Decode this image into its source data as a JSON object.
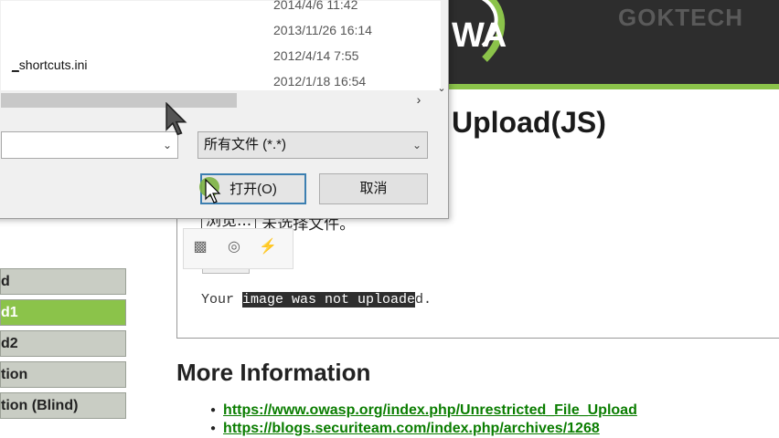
{
  "dialog": {
    "file_name": "shortcuts.ini",
    "dates": [
      "2014/4/6 11:42",
      "2013/11/26 16:14",
      "2012/4/14 7:55",
      "2012/1/18 16:54"
    ],
    "file_type": "所有文件 (*.*)",
    "open_label": "打开(O)",
    "cancel_label": "取消"
  },
  "header": {
    "logo_text": "WA",
    "watermark": "GOKTECH"
  },
  "page": {
    "title": "Upload(JS)",
    "browse_label": "浏览...",
    "no_file_text": "未选择文件。",
    "result_prefix": "Your ",
    "result_highlight": "image was not uploade",
    "result_suffix": "d."
  },
  "menu": {
    "items": [
      {
        "label": "d"
      },
      {
        "label": "d1"
      },
      {
        "label": "d2"
      },
      {
        "label": "tion"
      },
      {
        "label": "tion (Blind)"
      }
    ]
  },
  "more_info": {
    "heading": "More Information",
    "links": [
      "https://www.owasp.org/index.php/Unrestricted_File_Upload",
      "https://blogs.securiteam.com/index.php/archives/1268"
    ]
  },
  "colors": {
    "accent_green": "#8bc34a",
    "header_dark": "#2d2d2d",
    "link_green": "#0a7d00"
  }
}
